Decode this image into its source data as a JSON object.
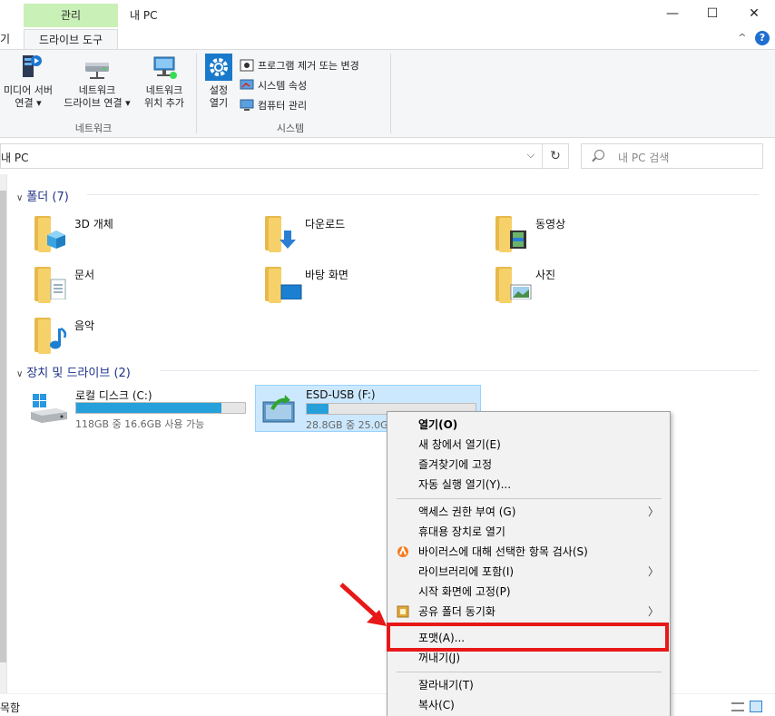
{
  "title_bar": {
    "context_tab": "관리",
    "window_title": "내 PC",
    "minimize": "—",
    "maximize": "☐",
    "close": "✕"
  },
  "ribbon_tabs": {
    "left_fragment": "기",
    "drive_tools": "드라이브 도구",
    "collapse_chevron": "^",
    "help": "?"
  },
  "ribbon": {
    "media_server_line1": "미디어 서버",
    "media_server_line2": "연결 ▾",
    "map_drive_line1": "네트워크",
    "map_drive_line2": "드라이브 연결 ▾",
    "add_location_line1": "네트워크",
    "add_location_line2": "위치 추가",
    "network_group": "네트워크",
    "settings_line1": "설정",
    "settings_line2": "열기",
    "uninstall": "프로그램 제거 또는 변경",
    "system_properties": "시스템 속성",
    "computer_management": "컴퓨터 관리",
    "system_group": "시스템"
  },
  "address": {
    "path": "내 PC",
    "dropdown": "⌵",
    "refresh": "↻",
    "search_placeholder": "내 PC 검색"
  },
  "sections": {
    "folders_header": "폴더 (7)",
    "devices_header": "장치 및 드라이브 (2)"
  },
  "folders": [
    {
      "label": "3D 개체"
    },
    {
      "label": "다운로드"
    },
    {
      "label": "동영상"
    },
    {
      "label": "문서"
    },
    {
      "label": "바탕 화면"
    },
    {
      "label": "사진"
    },
    {
      "label": "음악"
    }
  ],
  "drives": [
    {
      "name": "로컬 디스크 (C:)",
      "size": "118GB 중 16.6GB 사용 가능",
      "fill_fraction": 0.86
    },
    {
      "name": "ESD-USB (F:)",
      "size": "28.8GB 중 25.0GB 사용 가능",
      "fill_fraction": 0.13
    }
  ],
  "context_menu": {
    "open": "열기(O)",
    "open_new_window": "새 창에서 열기(E)",
    "pin_quick_access": "즐겨찾기에 고정",
    "autoplay": "자동 실행 열기(Y)...",
    "give_access": "액세스 권한 부여 (G)",
    "open_portable": "휴대용 장치로 열기",
    "avast_scan": "바이러스에 대해 선택한 항목 검사(S)",
    "include_library": "라이브러리에 포함(I)",
    "pin_start": "시작 화면에 고정(P)",
    "sync_shared": "공유 폴더 동기화",
    "format": "포맷(A)...",
    "eject": "꺼내기(J)",
    "cut": "잘라내기(T)",
    "copy": "복사(C)",
    "submenu_arrow": "〉"
  },
  "status_bar": {
    "text": "목함"
  },
  "colors": {
    "context_tab": "#c9f0b6",
    "selection": "#cce8ff",
    "drive_bar": "#26a0da",
    "highlight_red": "#e81818",
    "section_header": "#1e3287"
  }
}
